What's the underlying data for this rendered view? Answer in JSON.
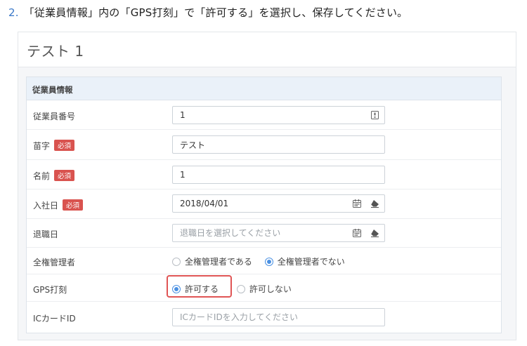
{
  "instruction": {
    "number": "2.",
    "text": "「従業員情報」内の「GPS打刻」で「許可する」を選択し、保存してください。"
  },
  "card": {
    "title": "テスト 1"
  },
  "section": {
    "title": "従業員情報"
  },
  "required_label": "必須",
  "fields": {
    "employee_number": {
      "label": "従業員番号",
      "value": "1",
      "icon": "id-card-icon"
    },
    "last_name": {
      "label": "苗字",
      "value": "テスト",
      "required": true
    },
    "first_name": {
      "label": "名前",
      "value": "1",
      "required": true
    },
    "hire_date": {
      "label": "入社日",
      "value": "2018/04/01",
      "required": true,
      "icons": [
        "calendar-icon",
        "eraser-icon"
      ]
    },
    "retire_date": {
      "label": "退職日",
      "value": "",
      "placeholder": "退職日を選択してください",
      "icons": [
        "calendar-icon",
        "eraser-icon"
      ]
    },
    "admin": {
      "label": "全権管理者",
      "options": [
        "全権管理者である",
        "全権管理者でない"
      ],
      "selected": "全権管理者でない"
    },
    "gps": {
      "label": "GPS打刻",
      "options": [
        "許可する",
        "許可しない"
      ],
      "selected": "許可する"
    },
    "ic_card": {
      "label": "ICカードID",
      "value": "",
      "placeholder": "ICカードIDを入力してください"
    }
  },
  "colors": {
    "accent": "#4a90e2",
    "required_badge": "#d9534f",
    "highlight": "#e05555",
    "section_header": "#eaf1f9"
  }
}
